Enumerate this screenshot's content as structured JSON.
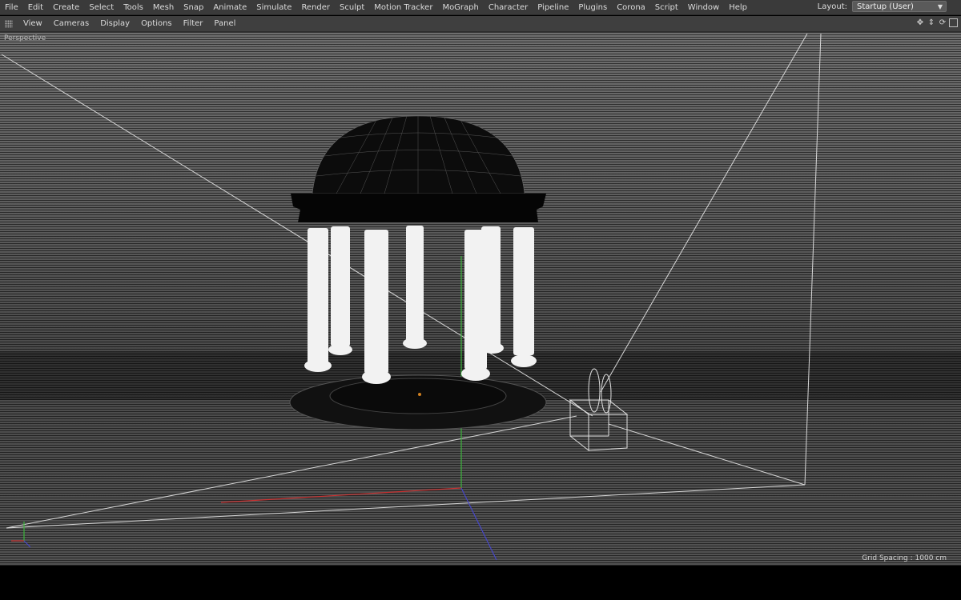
{
  "menubar": {
    "items": [
      "File",
      "Edit",
      "Create",
      "Select",
      "Tools",
      "Mesh",
      "Snap",
      "Animate",
      "Simulate",
      "Render",
      "Sculpt",
      "Motion Tracker",
      "MoGraph",
      "Character",
      "Pipeline",
      "Plugins",
      "Corona",
      "Script",
      "Window",
      "Help"
    ],
    "layout_label": "Layout:",
    "layout_value": "Startup (User)"
  },
  "viewbar": {
    "items": [
      "View",
      "Cameras",
      "Display",
      "Options",
      "Filter",
      "Panel"
    ]
  },
  "viewport": {
    "label": "Perspective",
    "grid_spacing": "Grid Spacing : 1000 cm"
  },
  "colors": {
    "menubar_bg": "#3a3a3a",
    "viewbar_bg": "#3f3f3f",
    "wireframe": "#ffffff",
    "axis_y": "#3cb43c",
    "axis_x": "#c83232",
    "axis_z": "#4646c8"
  },
  "icons": [
    "grip-icon",
    "move-icon",
    "zoom-icon",
    "rotate-icon",
    "maximize-icon"
  ]
}
